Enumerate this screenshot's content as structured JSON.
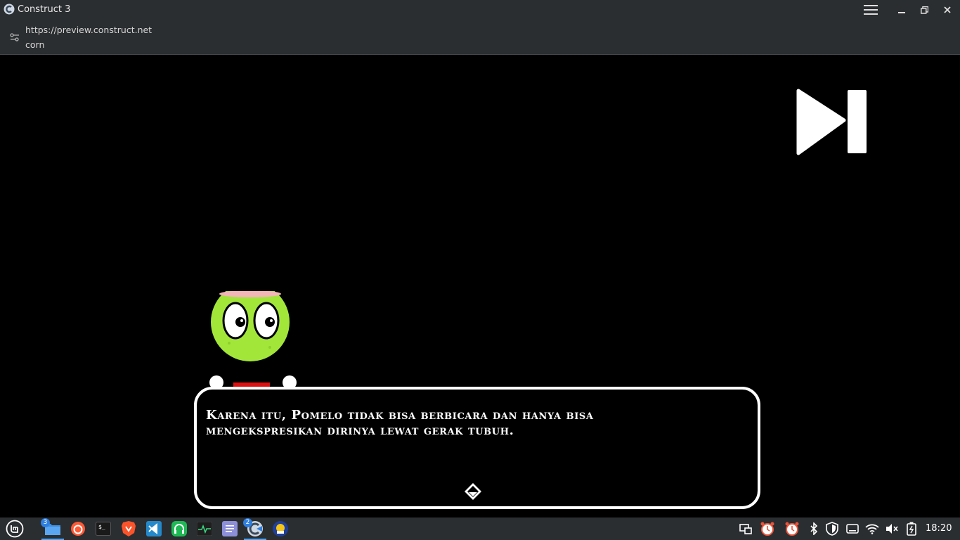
{
  "window": {
    "title": "Construct 3"
  },
  "urlbar": {
    "url": "https://preview.construct.net",
    "page_title": "corn"
  },
  "game": {
    "dialog": {
      "text_line1": "Karena itu, Pomelo tidak bisa berbicara dan hanya bisa",
      "text_line2": "mengekspresikan dirinya lewat gerak tubuh."
    }
  },
  "taskbar": {
    "items": [
      {
        "name": "mint-menu",
        "badge": null
      },
      {
        "name": "files",
        "badge": "3"
      },
      {
        "name": "firefox",
        "badge": null
      },
      {
        "name": "terminal",
        "badge": null
      },
      {
        "name": "brave",
        "badge": null
      },
      {
        "name": "vscode",
        "badge": null
      },
      {
        "name": "headset-app",
        "badge": null
      },
      {
        "name": "system-monitor",
        "badge": null
      },
      {
        "name": "text-editor",
        "badge": null
      },
      {
        "name": "construct-3",
        "badge": "2"
      },
      {
        "name": "kdeconnect",
        "badge": null
      }
    ],
    "clock": "18:20"
  },
  "colors": {
    "chrome": "#2b2e31",
    "character_green": "#a3e63a",
    "accent_blue": "#2f7fe0",
    "alarm_orange": "#e8543a"
  }
}
